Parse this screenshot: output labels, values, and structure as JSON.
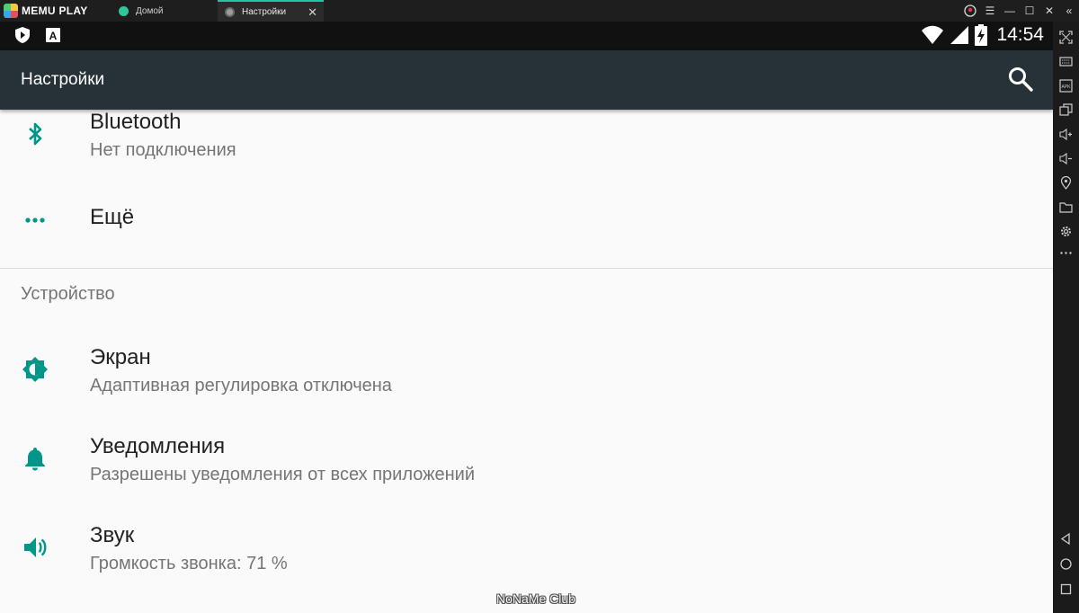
{
  "emulator": {
    "brand": "MEMU PLAY",
    "tabs": [
      {
        "label": "Домой",
        "active": false
      },
      {
        "label": "Настройки",
        "active": true
      }
    ],
    "accent_color": "#23c4a4"
  },
  "statusbar": {
    "time": "14:54"
  },
  "appbar": {
    "title": "Настройки",
    "background": "#263238"
  },
  "settings": {
    "items_top": [
      {
        "title": "Bluetooth",
        "subtitle": "Нет подключения",
        "icon": "bluetooth-icon"
      },
      {
        "title": "Ещё",
        "icon": "more-dots-icon"
      }
    ],
    "section_header": "Устройство",
    "items_device": [
      {
        "title": "Экран",
        "subtitle": "Адаптивная регулировка отключена",
        "icon": "brightness-icon"
      },
      {
        "title": "Уведомления",
        "subtitle": "Разрешены уведомления от всех приложений",
        "icon": "bell-icon"
      },
      {
        "title": "Звук",
        "subtitle": "Громкость звонка: 71 %",
        "icon": "volume-icon"
      }
    ],
    "icon_color": "#009688"
  },
  "watermark": "NoNaMe Club"
}
